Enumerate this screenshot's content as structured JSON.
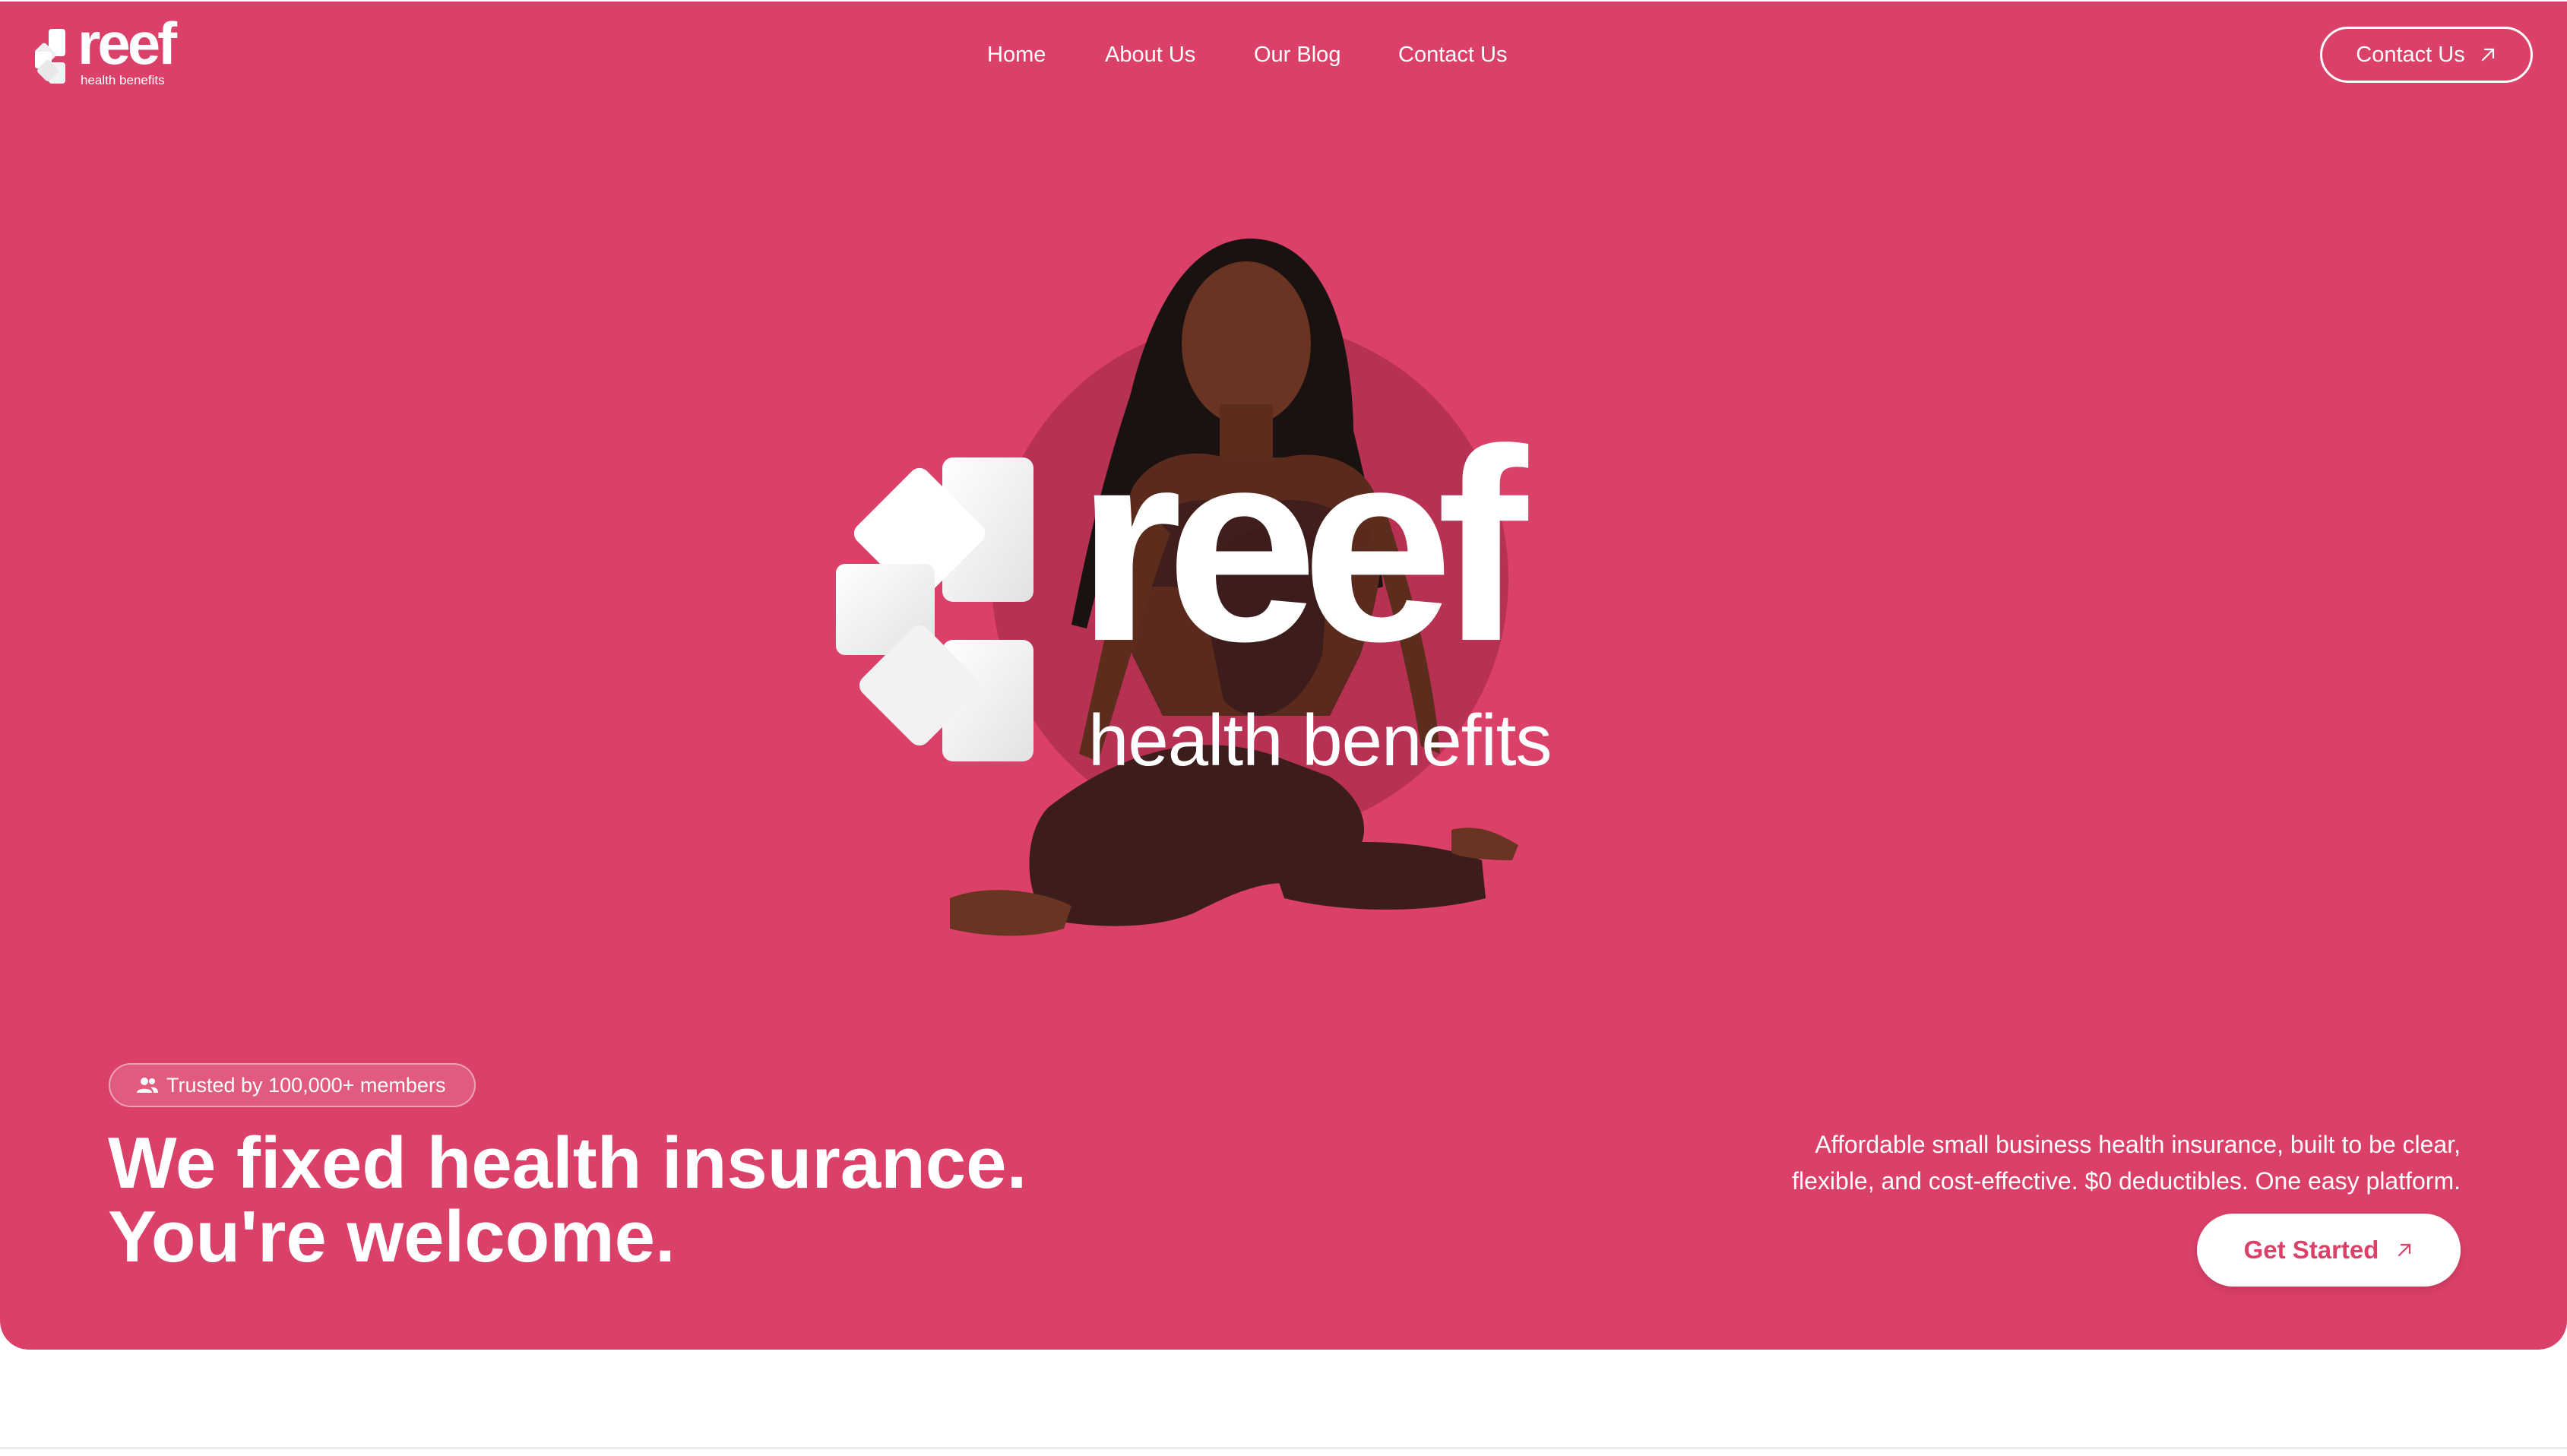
{
  "brand": {
    "name": "reef",
    "tagline": "health benefits",
    "accent_color": "#db4068"
  },
  "nav": {
    "links": [
      {
        "label": "Home"
      },
      {
        "label": "About Us"
      },
      {
        "label": "Our Blog"
      },
      {
        "label": "Contact Us"
      }
    ],
    "cta_label": "Contact Us",
    "cta_icon": "arrow-up-right-icon"
  },
  "hero": {
    "badge": {
      "icon": "users-icon",
      "text": "Trusted by 100,000+ members"
    },
    "headline_line1": "We fixed health insurance.",
    "headline_line2": "You're welcome.",
    "description_line1": "Affordable small business health insurance, built to be clear,",
    "description_line2": "flexible, and cost-effective. $0 deductibles. One easy platform.",
    "cta_label": "Get Started",
    "cta_icon": "arrow-up-right-icon",
    "image": "woman-yoga-pose-photo"
  }
}
